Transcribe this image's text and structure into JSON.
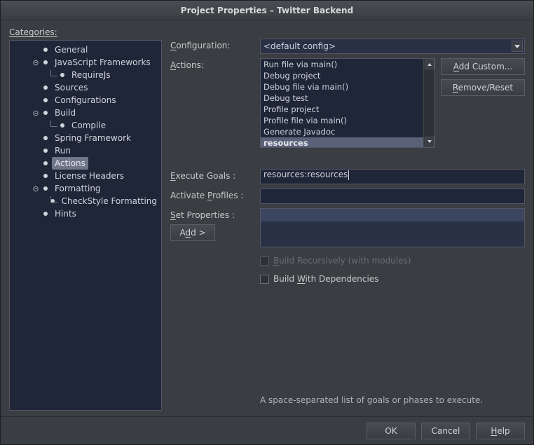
{
  "window": {
    "title": "Project Properties – Twitter Backend"
  },
  "categories": {
    "label": "Categories:",
    "tree": [
      {
        "label": "General",
        "depth": 2,
        "sel": false
      },
      {
        "label": "JavaScript Frameworks",
        "depth": 2,
        "expandable": true,
        "sel": false
      },
      {
        "label": "RequireJs",
        "depth": 3,
        "sel": false
      },
      {
        "label": "Sources",
        "depth": 2,
        "sel": false
      },
      {
        "label": "Configurations",
        "depth": 2,
        "sel": false
      },
      {
        "label": "Build",
        "depth": 2,
        "expandable": true,
        "sel": false
      },
      {
        "label": "Compile",
        "depth": 3,
        "sel": false
      },
      {
        "label": "Spring Framework",
        "depth": 2,
        "sel": false
      },
      {
        "label": "Run",
        "depth": 2,
        "sel": false
      },
      {
        "label": "Actions",
        "depth": 2,
        "sel": true
      },
      {
        "label": "License Headers",
        "depth": 2,
        "sel": false
      },
      {
        "label": "Formatting",
        "depth": 2,
        "expandable": true,
        "sel": false
      },
      {
        "label": "CheckStyle Formatting",
        "depth": 3,
        "sel": false
      },
      {
        "label": "Hints",
        "depth": 2,
        "sel": false
      }
    ]
  },
  "form": {
    "configuration_label": "Configuration:",
    "configuration_value": "<default config>",
    "actions_label": "Actions:",
    "actions_items": [
      "Run file via main()",
      "Debug project",
      "Debug file via main()",
      "Debug test",
      "Profile project",
      "Profile file via main()",
      "Generate Javadoc",
      "resources"
    ],
    "actions_selected": "resources",
    "execute_goals_label": "Execute Goals :",
    "execute_goals_value": "resources:resources",
    "activate_profiles_label": "Activate Profiles :",
    "activate_profiles_value": "",
    "set_properties_label": "Set Properties :",
    "add_label": "Add >",
    "build_recursively_label": "Build Recursively (with modules)",
    "build_with_deps_label": "Build With Dependencies",
    "hint": "A space-separated list of goals or phases to execute."
  },
  "side": {
    "add_custom": "Add Custom...",
    "remove_reset": "Remove/Reset"
  },
  "footer": {
    "ok": "OK",
    "cancel": "Cancel",
    "help": "Help"
  }
}
